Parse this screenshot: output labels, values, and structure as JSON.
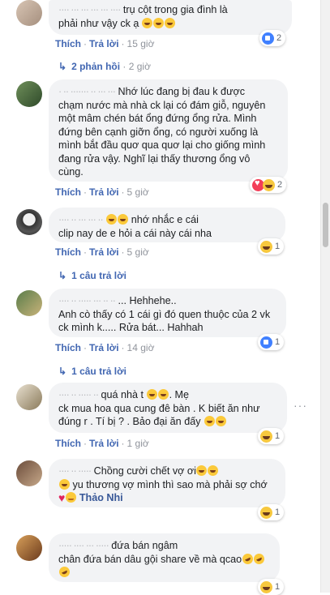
{
  "actions": {
    "like": "Thích",
    "reply": "Trả lời",
    "sep": "·"
  },
  "comments": [
    {
      "text_line1_blur": "···· ··· ··· ··· ··· ····",
      "text_line1": " trụ cột trong gia đình là",
      "text_line2": "phải như vậy ck ạ",
      "time": "15 giờ",
      "reaction_count": "2",
      "replies": "2 phản hồi",
      "replies_time": "2 giờ"
    },
    {
      "text_line1_blur": "· ·· ······· ·· ··· ···",
      "text_line1": "Nhớ lúc đang bị đau k được",
      "text_line2": "chạm nước mà nhà ck lại có đám giỗ, nguyên",
      "text_line3": "một mâm chén bát ổng đứng ổng rửa. Mình",
      "text_line4": "đứng bên cạnh giỡn ổng, có người xuống là",
      "text_line5": "mình bắt đầu quơ qua quơ lại cho giống mình",
      "text_line6": "đang rửa vậy. Nghĩ lại thấy thương ổng vô",
      "text_line7": "cùng.",
      "time": "5 giờ",
      "reaction_count": "2"
    },
    {
      "text_line1_blur": "···· ·· ··· ··· ··",
      "text_line1": " nhớ nhắc e cái",
      "text_line2": "clip nay de e hỏi a cái này cái nha",
      "time": "5 giờ",
      "reaction_count": "1",
      "replies": "1 câu trả lời"
    },
    {
      "text_line1_blur": "···· ·· ····· ··· ·· ··",
      "text_line1": "... Hehhehe..",
      "text_line2": "Anh cò thấy có 1 cái gì đó quen thuộc của 2 vk",
      "text_line3": "ck mình k..... Rửa bát... Hahhah",
      "time": "14 giờ",
      "reaction_count": "1",
      "replies": "1 câu trả lời"
    },
    {
      "text_line1_blur": "···· ·· ····· ··",
      "text_line1": "quá nhà t",
      "text_line1b": ". Mẹ",
      "text_line2": "ck mua hoa qua cung đê bàn . K biết ăn như",
      "text_line3": "đúng r . Tí bị ? . Bảo đại ăn đấy",
      "time": "1 giờ",
      "reaction_count": "1"
    },
    {
      "text_line1_blur": "···· ·· ·····",
      "text_line1": "Chồng cười chết vợ ơi",
      "text_line2": " yu thương vợ mình thì sao mà phải sợ chớ",
      "mention": "Thảo Nhi",
      "reaction_count": "1"
    },
    {
      "text_line1_blur": "····· ···· ··· ·····",
      "text_line1": "đứa bán ngâm",
      "text_line2": "chân đứa bán dâu gội share về mà qcao",
      "reaction_count": "1"
    }
  ]
}
